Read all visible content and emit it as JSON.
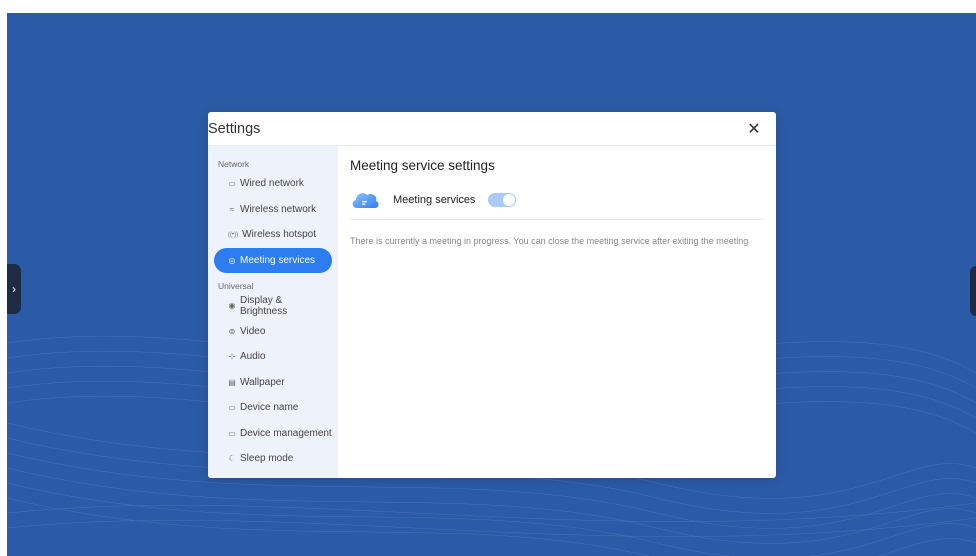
{
  "colors": {
    "background": "#2b5aa6",
    "accent": "#2d7cf0",
    "sidebar": "#eef2fb",
    "toggle_on": "#a9cbf6"
  },
  "dialog": {
    "title": "Settings",
    "close_icon": "close-icon"
  },
  "sidebar": {
    "groups": [
      {
        "label": "Network",
        "items": [
          {
            "label": "Wired network",
            "icon": "monitor-icon",
            "glyph": "▭"
          },
          {
            "label": "Wireless network",
            "icon": "wifi-icon",
            "glyph": "≈"
          },
          {
            "label": "Wireless hotspot",
            "icon": "hotspot-icon",
            "glyph": "((•))"
          },
          {
            "label": "Meeting services",
            "icon": "meeting-icon",
            "glyph": "◎",
            "active": true
          }
        ]
      },
      {
        "label": "Universal",
        "items": [
          {
            "label": "Display & Brightness",
            "icon": "eye-icon",
            "glyph": "◉"
          },
          {
            "label": "Video",
            "icon": "camera-icon",
            "glyph": "⊚"
          },
          {
            "label": "Audio",
            "icon": "audio-icon",
            "glyph": "⊹"
          },
          {
            "label": "Wallpaper",
            "icon": "wallpaper-icon",
            "glyph": "▤"
          },
          {
            "label": "Device name",
            "icon": "device-icon",
            "glyph": "▭"
          },
          {
            "label": "Device management",
            "icon": "device-management-icon",
            "glyph": "▭"
          },
          {
            "label": "Sleep mode",
            "icon": "sleep-icon",
            "glyph": "☾"
          }
        ]
      }
    ]
  },
  "main": {
    "title": "Meeting service settings",
    "service_label": "Meeting services",
    "toggle_state": "on",
    "note": "There is currently a meeting in progress. You can close the meeting service after exiting the meeting"
  }
}
